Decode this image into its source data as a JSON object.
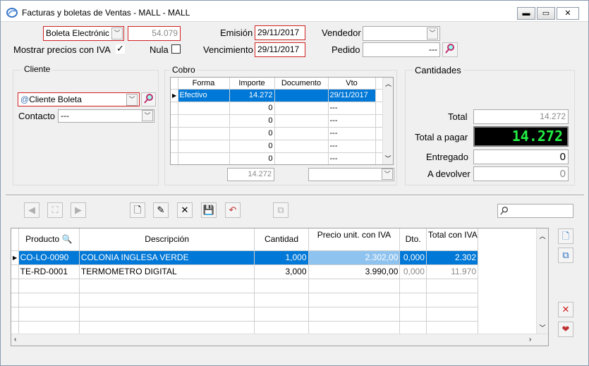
{
  "window": {
    "title": "Facturas y boletas de Ventas - MALL - MALL",
    "minimize_icon": "minimize-icon",
    "maximize_icon": "maximize-icon",
    "close_icon": "close-icon"
  },
  "header": {
    "doc_type": "Boleta Electrónic",
    "doc_number": "54.079",
    "emision_label": "Emisión",
    "emision_value": "29/11/2017",
    "vencimiento_label": "Vencimiento",
    "vencimiento_value": "29/11/2017",
    "vendedor_label": "Vendedor",
    "vendedor_value": "",
    "pedido_label": "Pedido",
    "pedido_value": "---",
    "mostrar_iva_label": "Mostrar precios con IVA",
    "mostrar_iva_checked": "✓",
    "nula_label": "Nula"
  },
  "cliente": {
    "group_label": "Cliente",
    "value": "Cliente Boleta",
    "contacto_label": "Contacto",
    "contacto_value": "---"
  },
  "cobro": {
    "group_label": "Cobro",
    "columns": [
      "Forma",
      "Importe",
      "Documento",
      "Vto"
    ],
    "rows": [
      [
        "Efectivo",
        "14.272",
        "",
        "29/11/2017"
      ],
      [
        "",
        "0",
        "",
        "---"
      ],
      [
        "",
        "0",
        "",
        "---"
      ],
      [
        "",
        "0",
        "",
        "---"
      ],
      [
        "",
        "0",
        "",
        "---"
      ],
      [
        "",
        "0",
        "",
        "---"
      ]
    ],
    "total": "14.272",
    "dropdown_value": ""
  },
  "cantidades": {
    "group_label": "Cantidades",
    "total_label": "Total",
    "total_value": "14.272",
    "total_pagar_label": "Total a pagar",
    "total_pagar_value": "14.272",
    "entregado_label": "Entregado",
    "entregado_value": "0",
    "devolver_label": "A devolver",
    "devolver_value": "0"
  },
  "items": {
    "columns": [
      "Producto",
      "Descripción",
      "Cantidad",
      "Precio unit. con IVA",
      "Dto.",
      "Total con IVA"
    ],
    "rows": [
      [
        "CO-LO-0090",
        "COLONIA INGLESA VERDE",
        "1,000",
        "2.302,00",
        "0,000",
        "2.302"
      ],
      [
        "TE-RD-0001",
        "TERMOMETRO DIGITAL",
        "3,000",
        "3.990,00",
        "0,000",
        "11.970"
      ],
      [
        "",
        "",
        "",
        "",
        "",
        ""
      ],
      [
        "",
        "",
        "",
        "",
        "",
        ""
      ],
      [
        "",
        "",
        "",
        "",
        "",
        ""
      ],
      [
        "",
        "",
        "",
        "",
        "",
        ""
      ]
    ]
  },
  "search": {
    "placeholder": ""
  },
  "colors": {
    "accent": "#0078d7",
    "led_green": "#22ee44",
    "red_border": "#d02020"
  }
}
